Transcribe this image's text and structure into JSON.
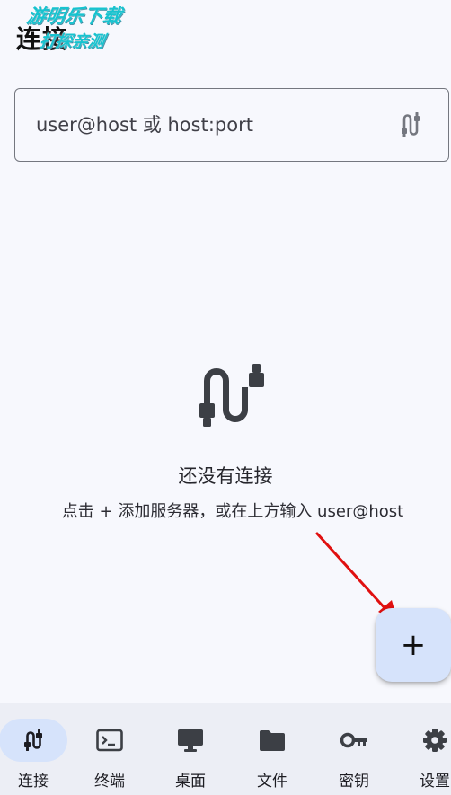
{
  "header": {
    "title": "连接",
    "watermark_line1": "游明乐下载",
    "watermark_line2": "打探亲测"
  },
  "search": {
    "placeholder": "user@host 或 host:port",
    "trailing_icon": "cable-icon"
  },
  "empty_state": {
    "icon": "cable-icon",
    "title": "还没有连接",
    "hint": "点击 + 添加服务器，或在上方输入 user@host"
  },
  "fab": {
    "label": "+"
  },
  "nav": {
    "items": [
      {
        "label": "连接",
        "icon": "cable-icon",
        "active": true
      },
      {
        "label": "终端",
        "icon": "terminal-icon",
        "active": false
      },
      {
        "label": "桌面",
        "icon": "desktop-icon",
        "active": false
      },
      {
        "label": "文件",
        "icon": "folder-icon",
        "active": false
      },
      {
        "label": "密钥",
        "icon": "key-icon",
        "active": false
      },
      {
        "label": "设置",
        "icon": "gear-icon",
        "active": false
      }
    ]
  },
  "colors": {
    "background": "#f7f8fd",
    "accent_container": "#d6e3fb",
    "nav_background": "#eceef5",
    "icon_gray": "#3c3f45",
    "annotation_arrow": "#e01010"
  }
}
